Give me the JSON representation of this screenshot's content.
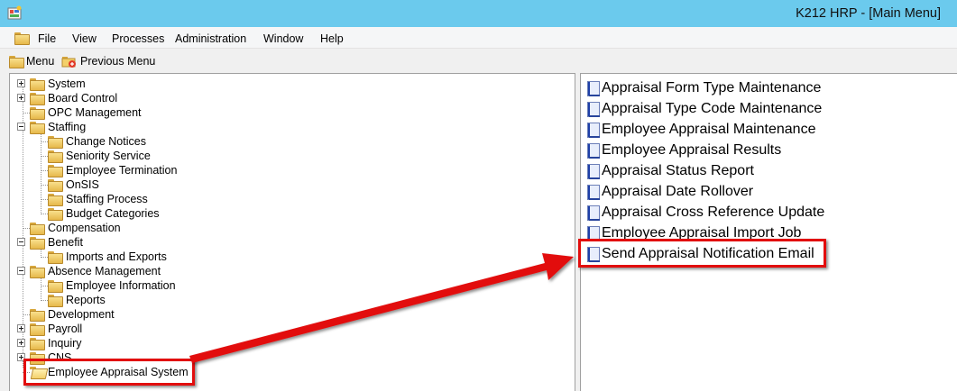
{
  "window": {
    "title": "K212 HRP - [Main Menu]"
  },
  "menubar": {
    "items": [
      "File",
      "View",
      "Processes",
      "Administration",
      "Window",
      "Help"
    ]
  },
  "toolbar": {
    "menu_label": "Menu",
    "previous_menu_label": "Previous Menu"
  },
  "tree": {
    "system": "System",
    "board_control": "Board Control",
    "opc_management": "OPC Management",
    "staffing": "Staffing",
    "change_notices": "Change Notices",
    "seniority_service": "Seniority Service",
    "employee_termination": "Employee Termination",
    "onsis": "OnSIS",
    "staffing_process": "Staffing Process",
    "budget_categories": "Budget Categories",
    "compensation": "Compensation",
    "benefit": "Benefit",
    "imports_and_exports": "Imports and Exports",
    "absence_management": "Absence Management",
    "employee_information": "Employee Information",
    "reports": "Reports",
    "development": "Development",
    "payroll": "Payroll",
    "inquiry": "Inquiry",
    "cns": "CNS",
    "employee_appraisal_system": "Employee Appraisal System"
  },
  "list": {
    "items": [
      "Appraisal Form Type Maintenance",
      "Appraisal Type Code Maintenance",
      "Employee Appraisal Maintenance",
      "Employee Appraisal Results",
      "Appraisal Status Report",
      "Appraisal Date Rollover",
      "Appraisal Cross Reference Update",
      "Employee Appraisal Import Job",
      "Send Appraisal Notification Email"
    ]
  },
  "colors": {
    "titlebar": "#6bcaed",
    "annotation": "#e20d0d",
    "folder": "#f3d06a",
    "document": "#1e3fa8"
  },
  "icons": [
    "app-icon",
    "folder-icon",
    "previous-menu-icon",
    "document-icon",
    "expand-plus-icon",
    "collapse-minus-icon"
  ]
}
